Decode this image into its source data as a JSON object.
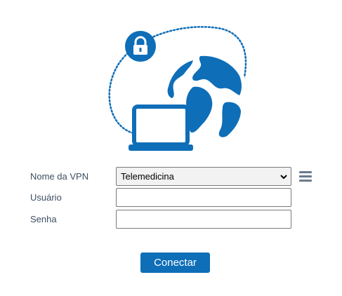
{
  "form": {
    "vpn_name_label": "Nome da VPN",
    "vpn_name_selected": "Telemedicina",
    "username_label": "Usuário",
    "username_value": "",
    "password_label": "Senha",
    "password_value": ""
  },
  "actions": {
    "connect_label": "Conectar"
  },
  "icons": {
    "illustration": "vpn-globe-laptop-lock-illustration",
    "menu": "hamburger-menu-icon",
    "dropdown": "chevron-down-icon"
  },
  "colors": {
    "accent": "#0e6eb8",
    "label_text": "#3d4f63"
  }
}
